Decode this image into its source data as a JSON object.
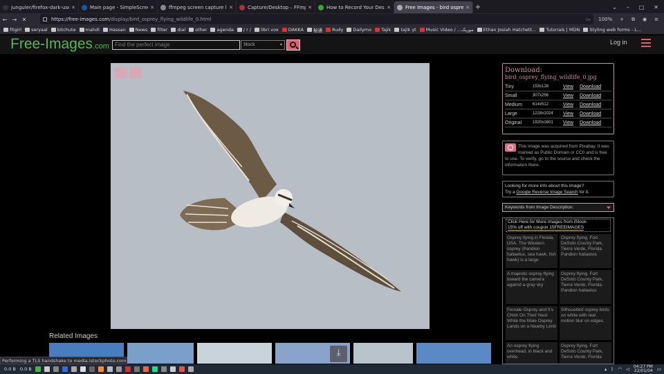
{
  "browser": {
    "tabs": [
      {
        "title": "junguler/firefox-dark-user",
        "color": "#333"
      },
      {
        "title": "Main page - SimpleScreen",
        "color": "#2255aa"
      },
      {
        "title": "ffmpeg screen capture lin",
        "color": "#888"
      },
      {
        "title": "Capture/Desktop – FFmpeg",
        "color": "#a33"
      },
      {
        "title": "How to Record Your Deskt",
        "color": "#3a3"
      },
      {
        "title": "Free Images - bird osprey",
        "color": "#aaa",
        "active": true
      }
    ],
    "new_tab": "+",
    "url_host": "https://free-images.com",
    "url_path": "/display/bird_osprey_flying_wildlife_0.html",
    "zoom": "100%",
    "bookmarks": [
      "fitgirl",
      "seryaal",
      "bitchute",
      "mahdi",
      "Hassan",
      "News",
      "filter",
      "dial",
      "other",
      "agenda",
      "/ r /",
      "libri vox",
      "DAKKA",
      "秘通",
      "Rudy",
      "Dailymo",
      "Tajik",
      "tajik yt",
      "Music Video / ...موزیک",
      "Ethan Josiah Hatchett...",
      "Tutorials | MDN",
      "Styling web forms - L..."
    ],
    "status": "Performing a TLS handshake to media.istockphoto.com..."
  },
  "site": {
    "logo_main": "Free-Images",
    "logo_tld": ".com",
    "search_placeholder": "Find the perfect image",
    "search_scope": "Stock",
    "login": "Log in"
  },
  "download": {
    "title": "Download:",
    "filename": "bird_osprey_flying_wildlife_0.jpg",
    "rows": [
      {
        "name": "Tiny",
        "size": "153x128",
        "view": "View",
        "dl": "Download"
      },
      {
        "name": "Small",
        "size": "307x256",
        "view": "View",
        "dl": "Download"
      },
      {
        "name": "Medium",
        "size": "614x512",
        "view": "View",
        "dl": "Download"
      },
      {
        "name": "Large",
        "size": "1228x1024",
        "view": "View",
        "dl": "Download"
      },
      {
        "name": "Original",
        "size": "1920x1601",
        "view": "View",
        "dl": "Download"
      }
    ]
  },
  "pixabay_note": "This image was acquired from Pixabay. It was marked as Public Domain or CC0 and is free to use. To verify, go to the source and check the information there.",
  "more_info": {
    "line1": "Looking for more info about this image?",
    "line2_pre": "Try a ",
    "line2_link": "Google Reverse Image Search",
    "line2_post": " for it."
  },
  "keywords_label": "Keywords from Image Description:",
  "istock": {
    "head1": "Click Here for More Images from iStock-",
    "head2": "15% off with coupon 15FREEIMAGES",
    "items": [
      "Osprey flying in Florida, USA. The Western osprey (Pandion haliaetus, sea hawk, fish hawk) is a large",
      "Osprey flying, Fort DeSoto County Park, Tierra Verde, Florida. Pandion haliaetus",
      "A majestic osprey flying toward the camera against a gray sky",
      "Osprey flying, Fort DeSoto County Park, Tierra Verde, Florida. Pandion haliaetus",
      "Female Osprey and It's Chick On Their Nest While the Male Osprey Lands on a Nearby Limb",
      "Silhouetted osprey birds on white with real motion blur on edges.",
      "An osprey flying overhead, in black and white.",
      "Osprey flying, Fort DeSoto County Park, Tierra Verde, Florida"
    ]
  },
  "related_title": "Related Images",
  "taskbar": {
    "net1": "0.0 B",
    "net2": "0.0 B",
    "time": "04:27 PM",
    "date": "22/01/04"
  }
}
